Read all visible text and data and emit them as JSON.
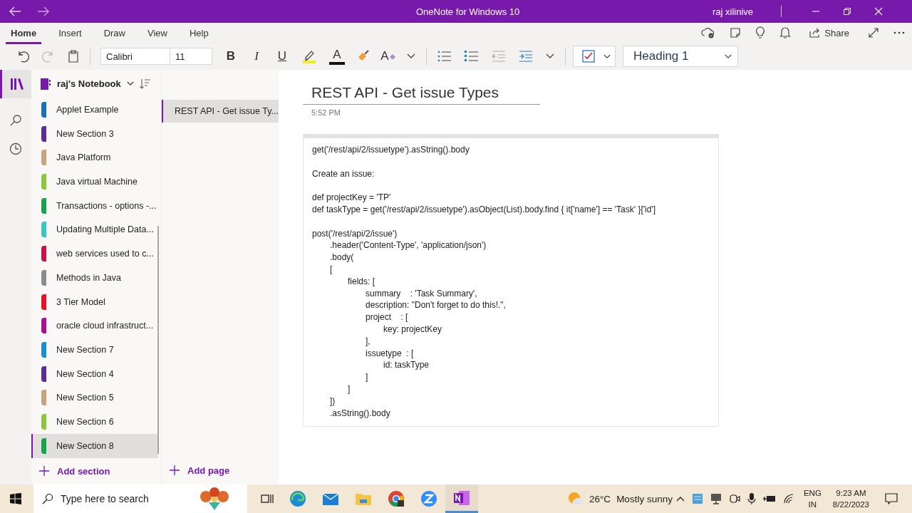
{
  "window": {
    "title": "OneNote for Windows 10",
    "user": "raj xilinive"
  },
  "ribbon_tabs": [
    {
      "label": "Home",
      "selected": true
    },
    {
      "label": "Insert",
      "selected": false
    },
    {
      "label": "Draw",
      "selected": false
    },
    {
      "label": "View",
      "selected": false
    },
    {
      "label": "Help",
      "selected": false
    }
  ],
  "toolbar": {
    "font": "Calibri",
    "size": "11",
    "bold": "B",
    "italic": "I",
    "underline": "U",
    "font_color_label": "A",
    "clear_format_label": "A",
    "style": "Heading 1",
    "share": "Share"
  },
  "notebook": {
    "name": "raj's Notebook"
  },
  "sections": [
    {
      "name": "Applet Example",
      "color": "#1b6fb5",
      "selected": false
    },
    {
      "name": "New Section 3",
      "color": "#5b2d91",
      "selected": false
    },
    {
      "name": "Java Platform",
      "color": "#c8a37b",
      "selected": false
    },
    {
      "name": "Java virtual Machine",
      "color": "#8cc63f",
      "selected": false
    },
    {
      "name": "Transactions - options -...",
      "color": "#17a34a",
      "selected": false
    },
    {
      "name": "Updating Multiple Data...",
      "color": "#3cc6c0",
      "selected": false
    },
    {
      "name": "web services used to c...",
      "color": "#c8104e",
      "selected": false
    },
    {
      "name": "Methods in Java",
      "color": "#8a8d8f",
      "selected": false
    },
    {
      "name": "3 Tier Model",
      "color": "#e81123",
      "selected": false
    },
    {
      "name": "oracle cloud infrastruct...",
      "color": "#a4128f",
      "selected": false
    },
    {
      "name": "New Section 7",
      "color": "#1a8fd0",
      "selected": false
    },
    {
      "name": "New Section 4",
      "color": "#5b2d91",
      "selected": false
    },
    {
      "name": "New Section 5",
      "color": "#c8a37b",
      "selected": false
    },
    {
      "name": "New Section 6",
      "color": "#8cc63f",
      "selected": false
    },
    {
      "name": "New Section 8",
      "color": "#17a34a",
      "selected": true
    }
  ],
  "add_section": "Add section",
  "pages": [
    {
      "title": "REST API - Get issue Ty...",
      "selected": true
    }
  ],
  "add_page": "Add page",
  "page": {
    "title": "REST API - Get issue Types",
    "time": "5:52 PM",
    "blocks": [
      [
        "get('/rest/api/2/issuetype').asString().body"
      ],
      [
        "Create an issue:"
      ],
      [
        "def projectKey = 'TP'",
        "def taskType = get('/rest/api/2/issuetype').asObject(List).body.find { it['name'] == 'Task' }['id']"
      ],
      [
        "post('/rest/api/2/issue')",
        "\t.header('Content-Type', 'application/json')",
        "\t.body(",
        "\t[",
        "\t\tfields: [",
        "\t\t\tsummary    : 'Task Summary',",
        "\t\t\tdescription: \"Don't forget to do this!.\",",
        "\t\t\tproject    : [",
        "\t\t\t\tkey: projectKey",
        "\t\t\t],",
        "\t\t\tissuetype  : [",
        "\t\t\t\tid: taskType",
        "\t\t\t]",
        "\t\t]",
        "\t])",
        "\t.asString().body"
      ]
    ]
  },
  "taskbar": {
    "search_placeholder": "Type here to search",
    "temperature": "26°C",
    "weather": "Mostly sunny",
    "language": "ENG",
    "region": "IN",
    "time": "9:23 AM",
    "date": "8/22/2023"
  }
}
